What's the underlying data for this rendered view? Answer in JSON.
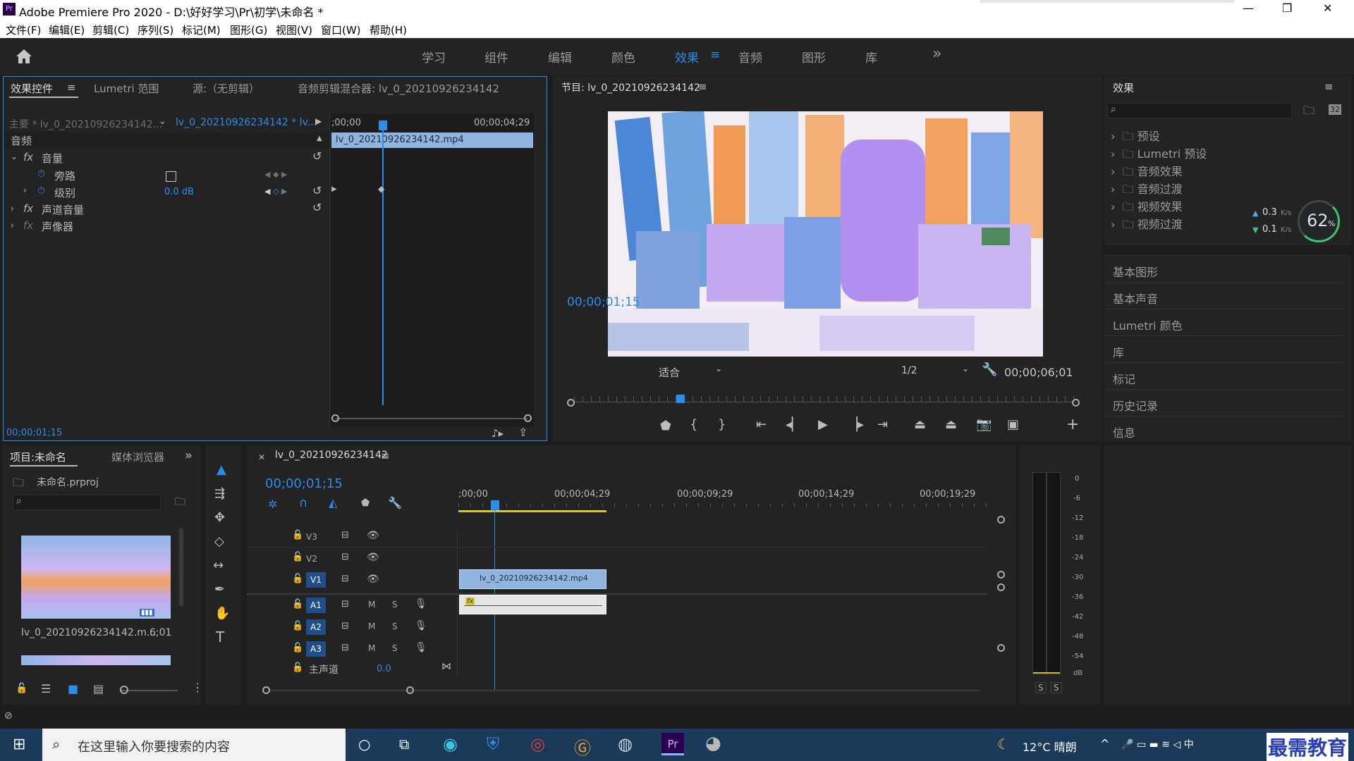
{
  "window": {
    "title": "Adobe Premiere Pro 2020 - D:\\好好学习\\Pr\\初学\\未命名 *",
    "controls": [
      "—",
      "❐",
      "✕"
    ]
  },
  "menu": [
    "文件(F)",
    "编辑(E)",
    "剪辑(C)",
    "序列(S)",
    "标记(M)",
    "图形(G)",
    "视图(V)",
    "窗口(W)",
    "帮助(H)"
  ],
  "workspaces": {
    "items": [
      "学习",
      "组件",
      "编辑",
      "颜色",
      "效果",
      "音频",
      "图形",
      "库"
    ],
    "active": "效果",
    "more": "»"
  },
  "effect_controls": {
    "tabs": [
      "效果控件",
      "Lumetri 范围",
      "源:（无剪辑）",
      "音频剪辑混合器: lv_0_20210926234142"
    ],
    "active_tab": "效果控件",
    "master_label": "主要 * lv_0_20210926234142...",
    "clip_label": "lv_0_20210926234142 * lv...",
    "time_start": ";00;00",
    "time_end": "00;00;04;29",
    "clip_name": "lv_0_20210926234142.mp4",
    "section": "音频",
    "rows": [
      {
        "label": "音量",
        "fx": "fx"
      },
      {
        "label": "旁路"
      },
      {
        "label": "级别",
        "value": "0.0 dB"
      },
      {
        "label": "声道音量",
        "fx": "fx"
      },
      {
        "label": "声像器",
        "fx": "fx"
      }
    ],
    "timecode": "00;00;01;15"
  },
  "program": {
    "title": "节目: lv_0_20210926234142",
    "timecode": "00;00;01;15",
    "fit": "适合",
    "resolution": "1/2",
    "duration": "00;00;06;01"
  },
  "effects_panel": {
    "title": "效果",
    "folders": [
      "预设",
      "Lumetri 预设",
      "音频效果",
      "音频过渡",
      "视频效果",
      "视频过渡"
    ],
    "net": {
      "up": "0.3",
      "down": "0.1",
      "unit": "K/s",
      "percent": "62",
      "percent_unit": "%"
    },
    "sections": [
      "基本图形",
      "基本声音",
      "Lumetri 颜色",
      "库",
      "标记",
      "历史记录",
      "信息"
    ]
  },
  "project": {
    "tabs": [
      "项目:未命名",
      "媒体浏览器"
    ],
    "project_file": "未命名.prproj",
    "item_name": "lv_0_20210926234142.m...",
    "item_duration": "6;01"
  },
  "timeline": {
    "sequence": "lv_0_20210926234142",
    "timecode": "00;00;01;15",
    "ruler": [
      ";00;00",
      "00;00;04;29",
      "00;00;09;29",
      "00;00;14;29",
      "00;00;19;29"
    ],
    "video_tracks": [
      "V3",
      "V2",
      "V1"
    ],
    "audio_tracks": [
      "A1",
      "A2",
      "A3"
    ],
    "master": "主声道",
    "master_value": "0.0",
    "clip_name": "lv_0_20210926234142.mp4"
  },
  "meter": {
    "scale": [
      "0",
      "-6",
      "-12",
      "-18",
      "-24",
      "-30",
      "-36",
      "-42",
      "-48",
      "-54",
      "dB"
    ],
    "buttons": [
      "S",
      "S"
    ]
  },
  "taskbar": {
    "search_placeholder": "在这里输入你要搜索的内容",
    "weather": "12°C 晴朗",
    "watermark": "最需教育"
  },
  "colors": {
    "accent": "#2d8ceb",
    "panel": "#232323",
    "clip": "#8fb4dd"
  }
}
